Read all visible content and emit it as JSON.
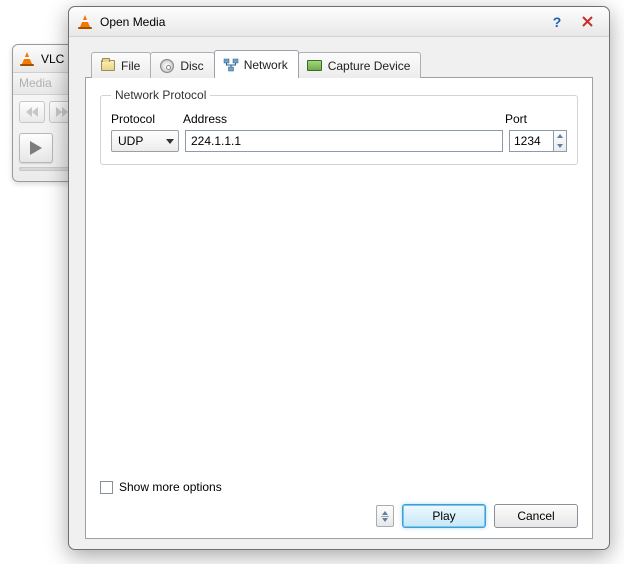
{
  "background_window": {
    "title": "VLC",
    "menu_label": "Media"
  },
  "dialog": {
    "title": "Open Media",
    "tabs": {
      "file": "File",
      "disc": "Disc",
      "network": "Network",
      "capture": "Capture Device"
    },
    "network": {
      "group_label": "Network Protocol",
      "labels": {
        "protocol": "Protocol",
        "address": "Address",
        "port": "Port"
      },
      "protocol_value": "UDP",
      "address_value": "224.1.1.1",
      "port_value": "1234"
    },
    "footer": {
      "show_more": "Show more options",
      "play": "Play",
      "cancel": "Cancel"
    }
  }
}
